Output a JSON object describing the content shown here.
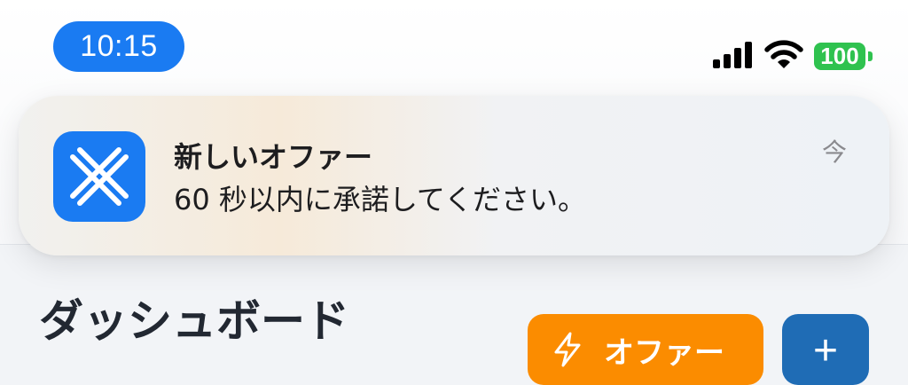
{
  "status_bar": {
    "time": "10:15",
    "battery_level": "100",
    "icons": [
      "signal-icon",
      "wifi-icon",
      "battery-icon"
    ]
  },
  "notification": {
    "app_icon": "close-x-icon",
    "title": "新しいオファー",
    "body": "60 秒以内に承諾してください。",
    "time": "今"
  },
  "page": {
    "title": "ダッシュボード"
  },
  "actions": {
    "offer_button_label": "オファー",
    "offer_button_icon": "lightning-icon",
    "add_button_label": "+"
  },
  "colors": {
    "accent_blue": "#1a7bf2",
    "battery_green": "#2fc24f",
    "offer_orange": "#fb8c00",
    "add_button_blue": "#1f6cb5"
  }
}
